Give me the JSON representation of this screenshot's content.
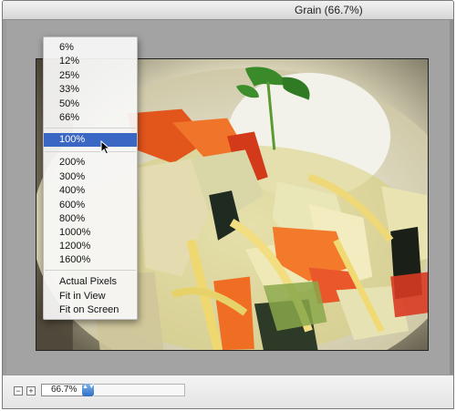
{
  "window": {
    "title": "Grain (66.7%)"
  },
  "statusbar": {
    "zoom_out_label": "−",
    "zoom_in_label": "+",
    "zoom_value": "66.7%",
    "stepper_glyph": "▲▼"
  },
  "zoom_menu": {
    "items_group1": [
      "6%",
      "12%",
      "25%",
      "33%",
      "50%",
      "66%"
    ],
    "selected": "100%",
    "items_group2": [
      "200%",
      "300%",
      "400%",
      "600%",
      "800%",
      "1000%",
      "1200%",
      "1600%"
    ],
    "items_group3": [
      "Actual Pixels",
      "Fit in View",
      "Fit on Screen"
    ]
  },
  "colors": {
    "selection": "#3a66c4",
    "stepper": "#2f6fc6"
  },
  "icons": {
    "cursor": "arrow-cursor-icon",
    "stepper": "up-down-stepper-icon"
  }
}
